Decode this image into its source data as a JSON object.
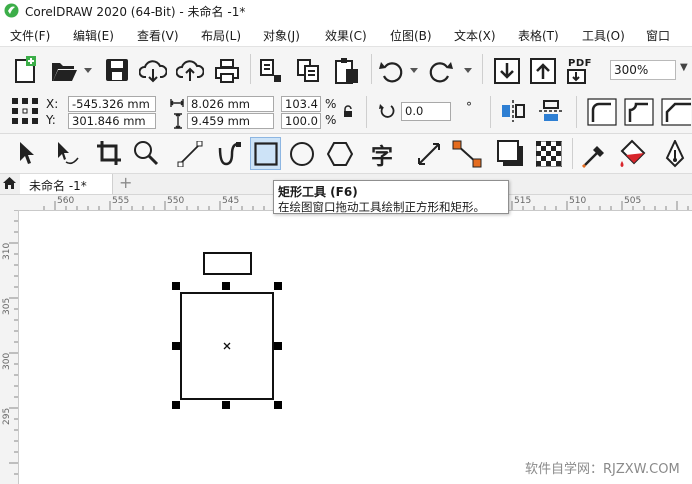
{
  "window": {
    "title": "CorelDRAW 2020 (64-Bit) - 未命名 -1*"
  },
  "menu": [
    {
      "label": "文件(F)"
    },
    {
      "label": "编辑(E)"
    },
    {
      "label": "查看(V)"
    },
    {
      "label": "布局(L)"
    },
    {
      "label": "对象(J)"
    },
    {
      "label": "效果(C)"
    },
    {
      "label": "位图(B)"
    },
    {
      "label": "文本(X)"
    },
    {
      "label": "表格(T)"
    },
    {
      "label": "工具(O)"
    },
    {
      "label": "窗口"
    }
  ],
  "standard_toolbar": {
    "pdf_label": "PDF",
    "zoom_value": "300%"
  },
  "property_bar": {
    "x_label": "X:",
    "y_label": "Y:",
    "x_value": "-545.326 mm",
    "y_value": "301.846 mm",
    "width_value": "8.026 mm",
    "height_value": "9.459 mm",
    "scale_w": "103.4",
    "scale_h": "100.0",
    "percent": "%",
    "rotation_value": "0.0",
    "degree": "°"
  },
  "toolbox": {
    "text_tool_glyph": "字"
  },
  "document_tab": {
    "label": "未命名 -1*",
    "add_label": "+"
  },
  "ruler": {
    "top_labels": [
      "560",
      "555",
      "550",
      "545",
      "540",
      "515",
      "510",
      "505"
    ],
    "left_labels": [
      "310",
      "305",
      "300",
      "295"
    ]
  },
  "tooltip": {
    "title": "矩形工具 (F6)",
    "description": "在绘图窗口拖动工具绘制正方形和矩形。"
  },
  "watermark": "软件自学网：RJZXW.COM",
  "colors": {
    "accent_blue": "#2e7fd3",
    "active_tool_bg": "#cde3f7",
    "logo_green": "#3cae49",
    "brand_orange": "#e46c1f"
  }
}
